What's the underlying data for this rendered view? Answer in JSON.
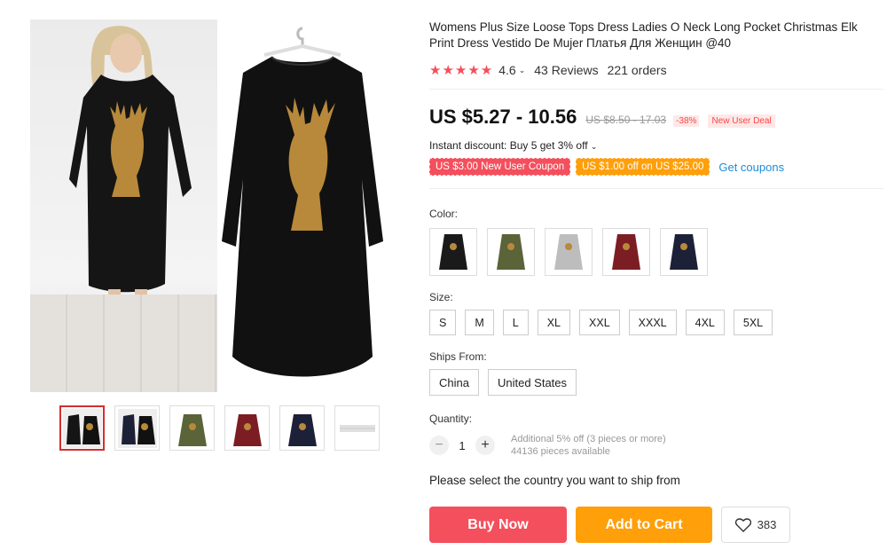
{
  "product": {
    "title": "Womens Plus Size Loose Tops Dress Ladies O Neck Long Pocket Christmas Elk Print Dress Vestido De Mujer Платья Для Женщин @40",
    "rating_value": "4.6",
    "reviews": "43 Reviews",
    "orders": "221 orders",
    "price": "US $5.27 - 10.56",
    "old_price": "US $8.50 - 17.03",
    "discount": "-38%",
    "deal_badge": "New User Deal",
    "instant_discount": "Instant discount: Buy 5 get 3% off",
    "coupons": [
      "US $3.00 New User Coupon",
      "US $1.00 off on US $25.00"
    ],
    "get_coupons": "Get coupons"
  },
  "color": {
    "label": "Color:",
    "options": [
      {
        "name": "black-olive",
        "color": "#1a1a1a"
      },
      {
        "name": "army-green",
        "color": "#5b6338"
      },
      {
        "name": "light-grey",
        "color": "#bdbdbd"
      },
      {
        "name": "wine-red",
        "color": "#7c1d24"
      },
      {
        "name": "navy",
        "color": "#1d2137"
      }
    ]
  },
  "size": {
    "label": "Size:",
    "options": [
      "S",
      "M",
      "L",
      "XL",
      "XXL",
      "XXXL",
      "4XL",
      "5XL"
    ]
  },
  "ships_from": {
    "label": "Ships From:",
    "options": [
      "China",
      "United States"
    ]
  },
  "quantity": {
    "label": "Quantity:",
    "value": "1",
    "note1": "Additional 5% off (3 pieces or more)",
    "note2": "44136 pieces available"
  },
  "select_country": "Please select the country you want to ship from",
  "buttons": {
    "buy_now": "Buy Now",
    "add_to_cart": "Add to Cart",
    "wishlist_count": "383"
  },
  "colors": {
    "accent_red": "#f44f5d",
    "accent_orange": "#ff9f0a",
    "link_blue": "#1a8dd8",
    "elk_gold": "#b8893a"
  },
  "gallery": {
    "thumbnail_colors": [
      "#1a1a1a",
      "#1d2137",
      "#5b6338",
      "#7c1d24",
      "#1d2137",
      "#e0e0e0"
    ]
  }
}
